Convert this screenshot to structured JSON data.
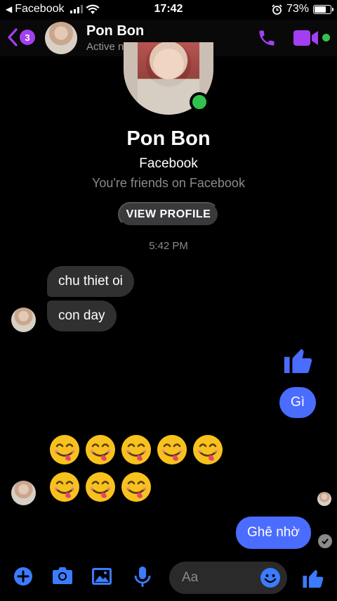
{
  "status_bar": {
    "carrier": "Facebook",
    "time": "17:42",
    "battery": "73%",
    "battery_level": 0.73
  },
  "header": {
    "unread_count": "3",
    "name": "Pon Bon",
    "status": "Active now"
  },
  "profile": {
    "name": "Pon Bon",
    "app": "Facebook",
    "relationship": "You're friends on Facebook",
    "view_profile_label": "VIEW PROFILE"
  },
  "timestamp": "5:42 PM",
  "messages": [
    {
      "direction": "incoming",
      "text": "chu thiet oi"
    },
    {
      "direction": "incoming",
      "text": "con day"
    },
    {
      "direction": "outgoing",
      "type": "like",
      "icon": "thumbs-up-icon"
    },
    {
      "direction": "outgoing",
      "text": "Gì"
    },
    {
      "direction": "incoming",
      "type": "emoji",
      "count": 8,
      "icon": "face-savoring-food-emoji"
    },
    {
      "direction": "outgoing",
      "text": "Ghê nhờ"
    }
  ],
  "composer": {
    "placeholder": "Aa"
  },
  "colors": {
    "accent": "#a33ff0",
    "outgoing_bubble": "#4a6cff",
    "incoming_bubble": "#303030",
    "online": "#31c24d",
    "icon_blue": "#3b7cff"
  }
}
